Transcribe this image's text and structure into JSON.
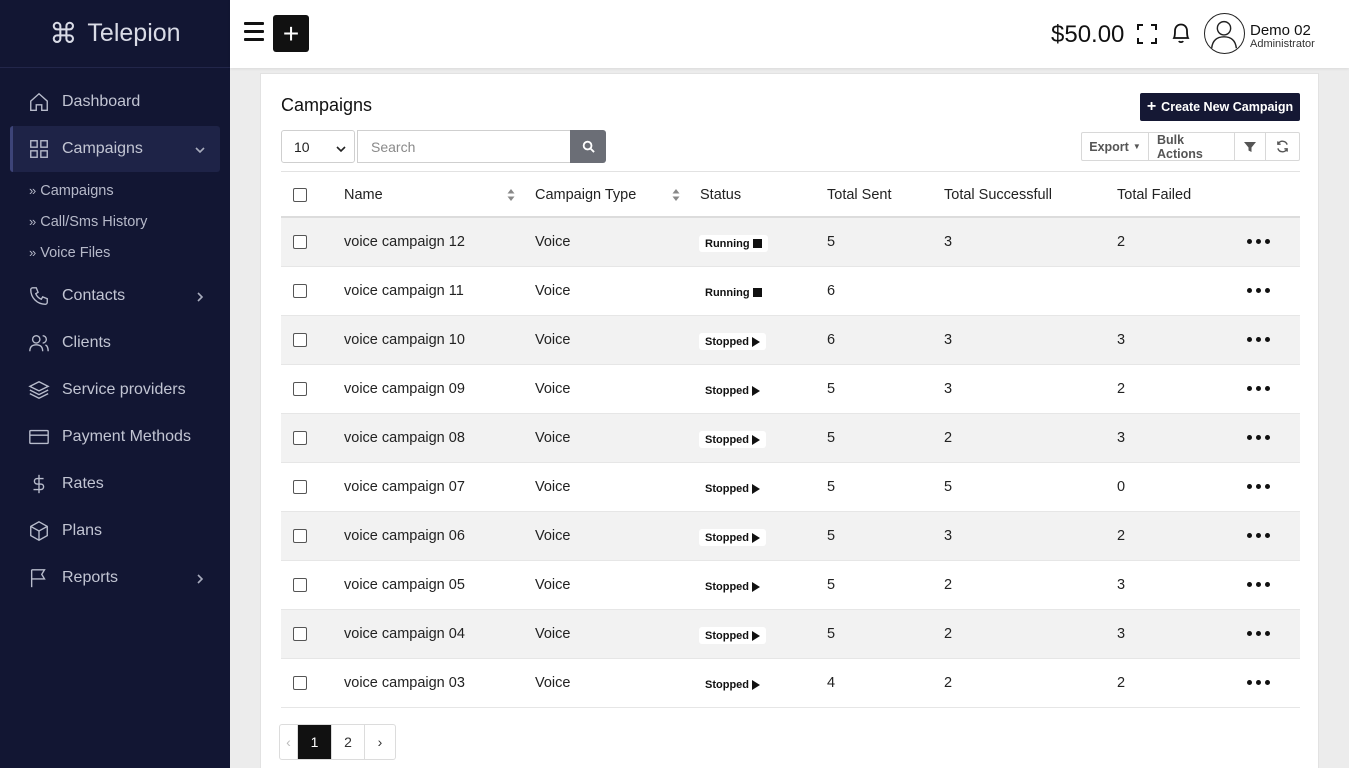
{
  "brand": {
    "name": "Telepion"
  },
  "sidebar": {
    "items": [
      {
        "label": "Dashboard",
        "icon": "home-icon"
      },
      {
        "label": "Campaigns",
        "icon": "grid-icon",
        "active": true,
        "expanded": true,
        "children": [
          "Campaigns",
          "Call/Sms History",
          "Voice Files"
        ]
      },
      {
        "label": "Contacts",
        "icon": "phone-icon",
        "has_children": true
      },
      {
        "label": "Clients",
        "icon": "users-icon"
      },
      {
        "label": "Service providers",
        "icon": "layers-icon"
      },
      {
        "label": "Payment Methods",
        "icon": "credit-card-icon"
      },
      {
        "label": "Rates",
        "icon": "dollar-icon"
      },
      {
        "label": "Plans",
        "icon": "box-icon"
      },
      {
        "label": "Reports",
        "icon": "flag-icon",
        "has_children": true
      }
    ]
  },
  "header": {
    "balance": "$50.00",
    "user_name": "Demo 02",
    "user_role": "Administrator"
  },
  "card": {
    "title": "Campaigns",
    "create_label": "Create New Campaign",
    "page_length": "10",
    "search_placeholder": "Search",
    "export_label": "Export",
    "bulk_label": "Bulk Actions"
  },
  "table": {
    "columns": [
      "Name",
      "Campaign Type",
      "Status",
      "Total Sent",
      "Total Successfull",
      "Total Failed"
    ],
    "rows": [
      {
        "name": "voice campaign 12",
        "type": "Voice",
        "status": "Running",
        "sent": "5",
        "success": "3",
        "failed": "2"
      },
      {
        "name": "voice campaign 11",
        "type": "Voice",
        "status": "Running",
        "sent": "6",
        "success": "",
        "failed": ""
      },
      {
        "name": "voice campaign 10",
        "type": "Voice",
        "status": "Stopped",
        "sent": "6",
        "success": "3",
        "failed": "3"
      },
      {
        "name": "voice campaign 09",
        "type": "Voice",
        "status": "Stopped",
        "sent": "5",
        "success": "3",
        "failed": "2"
      },
      {
        "name": "voice campaign 08",
        "type": "Voice",
        "status": "Stopped",
        "sent": "5",
        "success": "2",
        "failed": "3"
      },
      {
        "name": "voice campaign 07",
        "type": "Voice",
        "status": "Stopped",
        "sent": "5",
        "success": "5",
        "failed": "0"
      },
      {
        "name": "voice campaign 06",
        "type": "Voice",
        "status": "Stopped",
        "sent": "5",
        "success": "3",
        "failed": "2"
      },
      {
        "name": "voice campaign 05",
        "type": "Voice",
        "status": "Stopped",
        "sent": "5",
        "success": "2",
        "failed": "3"
      },
      {
        "name": "voice campaign 04",
        "type": "Voice",
        "status": "Stopped",
        "sent": "5",
        "success": "2",
        "failed": "3"
      },
      {
        "name": "voice campaign 03",
        "type": "Voice",
        "status": "Stopped",
        "sent": "4",
        "success": "2",
        "failed": "2"
      }
    ]
  },
  "pagination": {
    "prev": "‹",
    "pages": [
      "1",
      "2"
    ],
    "next": "›",
    "current": "1"
  }
}
